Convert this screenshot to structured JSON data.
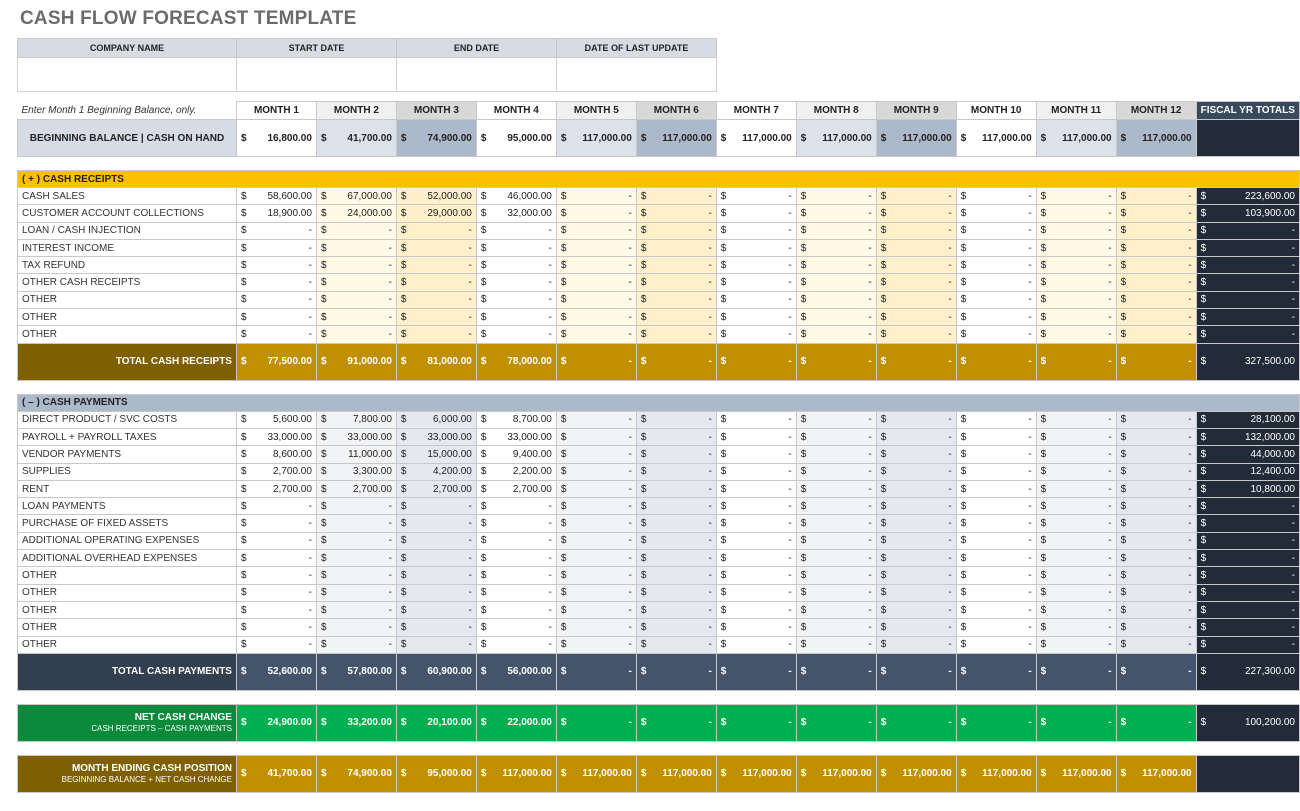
{
  "title": "CASH FLOW FORECAST TEMPLATE",
  "info": {
    "headers": [
      "COMPANY NAME",
      "START DATE",
      "END DATE",
      "DATE OF LAST UPDATE"
    ],
    "values": [
      "",
      "",
      "",
      ""
    ]
  },
  "hint": "Enter Month 1 Beginning Balance, only.",
  "months": [
    "MONTH 1",
    "MONTH 2",
    "MONTH 3",
    "MONTH 4",
    "MONTH 5",
    "MONTH 6",
    "MONTH 7",
    "MONTH 8",
    "MONTH 9",
    "MONTH 10",
    "MONTH 11",
    "MONTH 12"
  ],
  "fiscal_header": "FISCAL YR TOTALS",
  "currency": "$",
  "beginning_balance": {
    "label": "BEGINNING BALANCE  |  CASH ON HAND",
    "values": [
      "16,800.00",
      "41,700.00",
      "74,900.00",
      "95,000.00",
      "117,000.00",
      "117,000.00",
      "117,000.00",
      "117,000.00",
      "117,000.00",
      "117,000.00",
      "117,000.00",
      "117,000.00"
    ],
    "total": ""
  },
  "receipts": {
    "header": "( + )  CASH RECEIPTS",
    "rows": [
      {
        "label": "CASH SALES",
        "values": [
          "58,600.00",
          "67,000.00",
          "52,000.00",
          "46,000.00",
          "-",
          "-",
          "-",
          "-",
          "-",
          "-",
          "-",
          "-"
        ],
        "total": "223,600.00"
      },
      {
        "label": "CUSTOMER ACCOUNT COLLECTIONS",
        "values": [
          "18,900.00",
          "24,000.00",
          "29,000.00",
          "32,000.00",
          "-",
          "-",
          "-",
          "-",
          "-",
          "-",
          "-",
          "-"
        ],
        "total": "103,900.00"
      },
      {
        "label": "LOAN / CASH INJECTION",
        "values": [
          "-",
          "-",
          "-",
          "-",
          "-",
          "-",
          "-",
          "-",
          "-",
          "-",
          "-",
          "-"
        ],
        "total": "-"
      },
      {
        "label": "INTEREST INCOME",
        "values": [
          "-",
          "-",
          "-",
          "-",
          "-",
          "-",
          "-",
          "-",
          "-",
          "-",
          "-",
          "-"
        ],
        "total": "-"
      },
      {
        "label": "TAX REFUND",
        "values": [
          "-",
          "-",
          "-",
          "-",
          "-",
          "-",
          "-",
          "-",
          "-",
          "-",
          "-",
          "-"
        ],
        "total": "-"
      },
      {
        "label": "OTHER CASH RECEIPTS",
        "values": [
          "-",
          "-",
          "-",
          "-",
          "-",
          "-",
          "-",
          "-",
          "-",
          "-",
          "-",
          "-"
        ],
        "total": "-"
      },
      {
        "label": "OTHER",
        "values": [
          "-",
          "-",
          "-",
          "-",
          "-",
          "-",
          "-",
          "-",
          "-",
          "-",
          "-",
          "-"
        ],
        "total": "-"
      },
      {
        "label": "OTHER",
        "values": [
          "-",
          "-",
          "-",
          "-",
          "-",
          "-",
          "-",
          "-",
          "-",
          "-",
          "-",
          "-"
        ],
        "total": "-"
      },
      {
        "label": "OTHER",
        "values": [
          "-",
          "-",
          "-",
          "-",
          "-",
          "-",
          "-",
          "-",
          "-",
          "-",
          "-",
          "-"
        ],
        "total": "-"
      }
    ],
    "total_label": "TOTAL CASH RECEIPTS",
    "totals": [
      "77,500.00",
      "91,000.00",
      "81,000.00",
      "78,000.00",
      "-",
      "-",
      "-",
      "-",
      "-",
      "-",
      "-",
      "-"
    ],
    "grand_total": "327,500.00"
  },
  "payments": {
    "header": "( – )  CASH PAYMENTS",
    "rows": [
      {
        "label": "DIRECT PRODUCT / SVC COSTS",
        "values": [
          "5,600.00",
          "7,800.00",
          "6,000.00",
          "8,700.00",
          "-",
          "-",
          "-",
          "-",
          "-",
          "-",
          "-",
          "-"
        ],
        "total": "28,100.00"
      },
      {
        "label": "PAYROLL + PAYROLL TAXES",
        "values": [
          "33,000.00",
          "33,000.00",
          "33,000.00",
          "33,000.00",
          "-",
          "-",
          "-",
          "-",
          "-",
          "-",
          "-",
          "-"
        ],
        "total": "132,000.00"
      },
      {
        "label": "VENDOR PAYMENTS",
        "values": [
          "8,600.00",
          "11,000.00",
          "15,000.00",
          "9,400.00",
          "-",
          "-",
          "-",
          "-",
          "-",
          "-",
          "-",
          "-"
        ],
        "total": "44,000.00"
      },
      {
        "label": "SUPPLIES",
        "values": [
          "2,700.00",
          "3,300.00",
          "4,200.00",
          "2,200.00",
          "-",
          "-",
          "-",
          "-",
          "-",
          "-",
          "-",
          "-"
        ],
        "total": "12,400.00"
      },
      {
        "label": "RENT",
        "values": [
          "2,700.00",
          "2,700.00",
          "2,700.00",
          "2,700.00",
          "-",
          "-",
          "-",
          "-",
          "-",
          "-",
          "-",
          "-"
        ],
        "total": "10,800.00"
      },
      {
        "label": "LOAN PAYMENTS",
        "values": [
          "-",
          "-",
          "-",
          "-",
          "-",
          "-",
          "-",
          "-",
          "-",
          "-",
          "-",
          "-"
        ],
        "total": "-"
      },
      {
        "label": "PURCHASE OF FIXED ASSETS",
        "values": [
          "-",
          "-",
          "-",
          "-",
          "-",
          "-",
          "-",
          "-",
          "-",
          "-",
          "-",
          "-"
        ],
        "total": "-"
      },
      {
        "label": "ADDITIONAL OPERATING EXPENSES",
        "values": [
          "-",
          "-",
          "-",
          "-",
          "-",
          "-",
          "-",
          "-",
          "-",
          "-",
          "-",
          "-"
        ],
        "total": "-"
      },
      {
        "label": "ADDITIONAL OVERHEAD EXPENSES",
        "values": [
          "-",
          "-",
          "-",
          "-",
          "-",
          "-",
          "-",
          "-",
          "-",
          "-",
          "-",
          "-"
        ],
        "total": "-"
      },
      {
        "label": "OTHER",
        "values": [
          "-",
          "-",
          "-",
          "-",
          "-",
          "-",
          "-",
          "-",
          "-",
          "-",
          "-",
          "-"
        ],
        "total": "-"
      },
      {
        "label": "OTHER",
        "values": [
          "-",
          "-",
          "-",
          "-",
          "-",
          "-",
          "-",
          "-",
          "-",
          "-",
          "-",
          "-"
        ],
        "total": "-"
      },
      {
        "label": "OTHER",
        "values": [
          "-",
          "-",
          "-",
          "-",
          "-",
          "-",
          "-",
          "-",
          "-",
          "-",
          "-",
          "-"
        ],
        "total": "-"
      },
      {
        "label": "OTHER",
        "values": [
          "-",
          "-",
          "-",
          "-",
          "-",
          "-",
          "-",
          "-",
          "-",
          "-",
          "-",
          "-"
        ],
        "total": "-"
      },
      {
        "label": "OTHER",
        "values": [
          "-",
          "-",
          "-",
          "-",
          "-",
          "-",
          "-",
          "-",
          "-",
          "-",
          "-",
          "-"
        ],
        "total": "-"
      }
    ],
    "total_label": "TOTAL CASH PAYMENTS",
    "totals": [
      "52,600.00",
      "57,800.00",
      "60,900.00",
      "56,000.00",
      "-",
      "-",
      "-",
      "-",
      "-",
      "-",
      "-",
      "-"
    ],
    "grand_total": "227,300.00"
  },
  "net_change": {
    "label": "NET CASH CHANGE",
    "sublabel": "CASH RECEIPTS – CASH PAYMENTS",
    "values": [
      "24,900.00",
      "33,200.00",
      "20,100.00",
      "22,000.00",
      "-",
      "-",
      "-",
      "-",
      "-",
      "-",
      "-",
      "-"
    ],
    "total": "100,200.00"
  },
  "ending_position": {
    "label": "MONTH ENDING CASH POSITION",
    "sublabel": "BEGINNING BALANCE + NET CASH CHANGE",
    "values": [
      "41,700.00",
      "74,900.00",
      "95,000.00",
      "117,000.00",
      "117,000.00",
      "117,000.00",
      "117,000.00",
      "117,000.00",
      "117,000.00",
      "117,000.00",
      "117,000.00",
      "117,000.00"
    ],
    "total": ""
  }
}
